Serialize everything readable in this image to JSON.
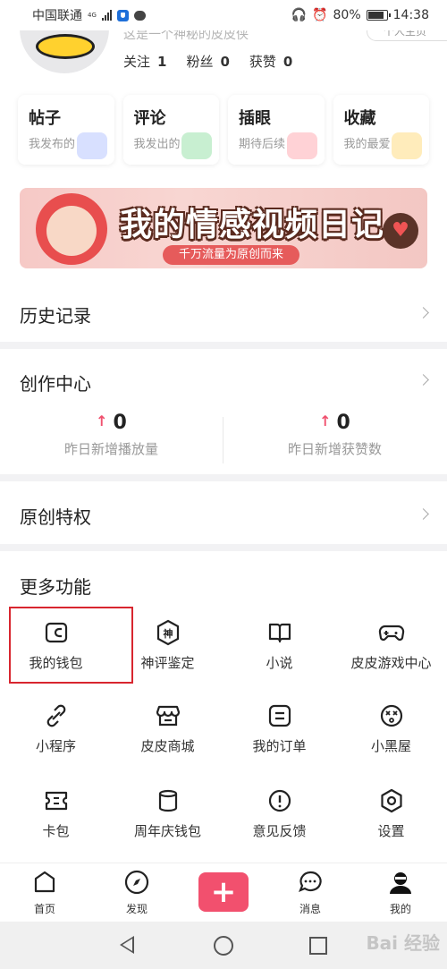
{
  "status_bar": {
    "carrier": "中国联通",
    "network": "4G",
    "battery": "80%",
    "time": "14:38"
  },
  "profile": {
    "faded_line": "这是一个神秘的皮皮侠",
    "top_pill": "个人主页",
    "stats": [
      {
        "label": "关注",
        "value": "1"
      },
      {
        "label": "粉丝",
        "value": "0"
      },
      {
        "label": "获赞",
        "value": "0"
      }
    ]
  },
  "quick_cards": [
    {
      "title": "帖子",
      "subtitle": "我发布的",
      "color": "#8fa6ff"
    },
    {
      "title": "评论",
      "subtitle": "我发出的",
      "color": "#62d27a"
    },
    {
      "title": "插眼",
      "subtitle": "期待后续",
      "color": "#ff7d8a"
    },
    {
      "title": "收藏",
      "subtitle": "我的最爱",
      "color": "#ffc83d"
    }
  ],
  "banner": {
    "title": "我的情感视频日记",
    "subtitle": "千万流量为原创而来"
  },
  "history": {
    "title": "历史记录"
  },
  "creator": {
    "title": "创作中心",
    "metrics": [
      {
        "value": "0",
        "label": "昨日新增播放量"
      },
      {
        "value": "0",
        "label": "昨日新增获赞数"
      }
    ]
  },
  "original": {
    "title": "原创特权"
  },
  "more": {
    "title": "更多功能",
    "items": [
      {
        "label": "我的钱包",
        "icon": "wallet-icon"
      },
      {
        "label": "神评鉴定",
        "icon": "shen-badge-icon"
      },
      {
        "label": "小说",
        "icon": "book-icon"
      },
      {
        "label": "皮皮游戏中心",
        "icon": "gamepad-icon"
      },
      {
        "label": "小程序",
        "icon": "link-icon"
      },
      {
        "label": "皮皮商城",
        "icon": "store-icon"
      },
      {
        "label": "我的订单",
        "icon": "order-icon"
      },
      {
        "label": "小黑屋",
        "icon": "dizzy-face-icon"
      },
      {
        "label": "卡包",
        "icon": "ticket-icon"
      },
      {
        "label": "周年庆钱包",
        "icon": "cylinder-icon"
      },
      {
        "label": "意见反馈",
        "icon": "exclamation-icon"
      },
      {
        "label": "设置",
        "icon": "settings-icon"
      }
    ]
  },
  "bottom_nav": {
    "items": [
      {
        "label": "首页"
      },
      {
        "label": "发现"
      },
      {
        "label": "消息"
      },
      {
        "label": "我的"
      }
    ],
    "plus": "+"
  },
  "colors": {
    "accent": "#f2506e",
    "highlight_box": "#d8262f"
  },
  "watermark": "Bai 经验"
}
